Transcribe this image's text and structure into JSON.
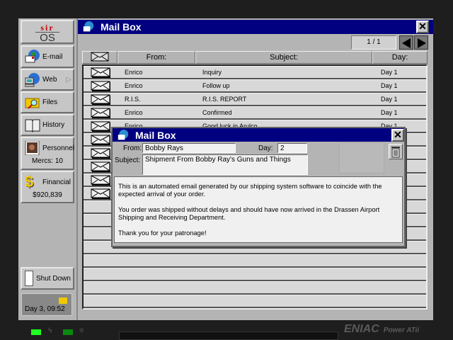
{
  "sidebar": {
    "logo_top": "sir",
    "logo_bottom": "OS",
    "items": [
      {
        "label": "E-mail"
      },
      {
        "label": "Web"
      },
      {
        "label": "Files"
      },
      {
        "label": "History"
      },
      {
        "label": "Personnel",
        "sub": "Mercs: 10"
      },
      {
        "label": "Financial",
        "sub": "$920,839"
      }
    ],
    "shutdown": "Shut Down",
    "clock": "Day 3, 09:52"
  },
  "mailbox": {
    "title": "Mail Box",
    "page": "1 / 1",
    "columns": [
      "From:",
      "Subject:",
      "Day:"
    ],
    "rows": [
      {
        "from": "Enrico",
        "subject": "Inquiry",
        "day": "Day 1"
      },
      {
        "from": "Enrico",
        "subject": "Follow up",
        "day": "Day 1"
      },
      {
        "from": "R.I.S.",
        "subject": "R.I.S. REPORT",
        "day": "Day 1"
      },
      {
        "from": "Enrico",
        "subject": "Confirmed",
        "day": "Day 1"
      },
      {
        "from": "Enrico",
        "subject": "Good luck in Arulco",
        "day": "Day 1"
      }
    ]
  },
  "message": {
    "title": "Mail Box",
    "from_label": "From:",
    "from": "Bobby Rays",
    "day_label": "Day:",
    "day": "2",
    "subject_label": "Subject:",
    "subject": "Shipment From Bobby Ray's Guns and Things",
    "body": [
      "This is an automated email generated by our shipping system software to coincide with the expected arrival of your order.",
      "You order was shipped without delays and should have now arrived in the Drassen Airport Shipping and Receiving Department.",
      "Thank you for your patronage!"
    ]
  },
  "bezel": {
    "brand": "ENIAC",
    "model": "Power ATii"
  }
}
